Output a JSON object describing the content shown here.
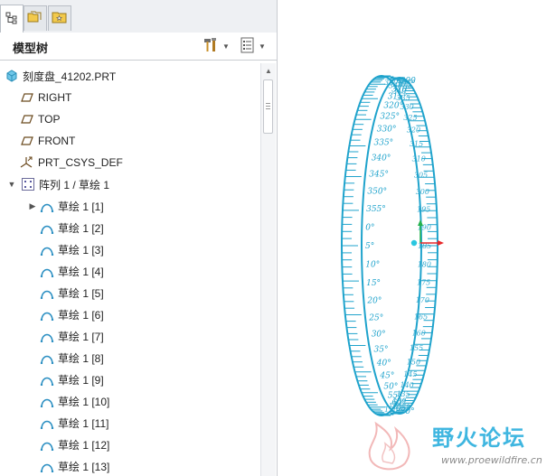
{
  "panel": {
    "title": "模型树"
  },
  "tree": {
    "root": {
      "label": "刻度盘_41202.PRT"
    },
    "items": [
      {
        "label": "RIGHT"
      },
      {
        "label": "TOP"
      },
      {
        "label": "FRONT"
      },
      {
        "label": "PRT_CSYS_DEF"
      }
    ],
    "pattern": {
      "label": "阵列 1 / 草绘 1"
    },
    "sketches": [
      {
        "label": "草绘 1 [1]"
      },
      {
        "label": "草绘 1 [2]"
      },
      {
        "label": "草绘 1 [3]"
      },
      {
        "label": "草绘 1 [4]"
      },
      {
        "label": "草绘 1 [5]"
      },
      {
        "label": "草绘 1 [6]"
      },
      {
        "label": "草绘 1 [7]"
      },
      {
        "label": "草绘 1 [8]"
      },
      {
        "label": "草绘 1 [9]"
      },
      {
        "label": "草绘 1 [10]"
      },
      {
        "label": "草绘 1 [11]"
      },
      {
        "label": "草绘 1 [12]"
      },
      {
        "label": "草绘 1 [13]"
      }
    ]
  },
  "viewport": {
    "dial_labels_front": [
      "300",
      "305°",
      "310°",
      "315°",
      "320°",
      "325°",
      "330°",
      "335°",
      "340°",
      "345°",
      "350°",
      "355°",
      "0°",
      "5°",
      "10°",
      "15°",
      "20°",
      "25°",
      "30°",
      "35°",
      "40°",
      "45°",
      "50°",
      "55°",
      "60°",
      "65°",
      "70°"
    ],
    "dial_labels_back": [
      "350",
      "345",
      "340",
      "335",
      "330",
      "325",
      "320",
      "315",
      "310",
      "305",
      "300",
      "195",
      "190",
      "185",
      "180",
      "175",
      "170",
      "165",
      "160",
      "155",
      "150",
      "145",
      "140",
      "135",
      "130",
      "125",
      "120"
    ],
    "colors": {
      "dial": "#1fa3cc",
      "axis_x": "#e8282a",
      "axis_y": "#22b14c",
      "axis_z": "#29c7e0"
    }
  },
  "watermark": {
    "title": "野火论坛",
    "url": "www.proewildfire.cn"
  }
}
